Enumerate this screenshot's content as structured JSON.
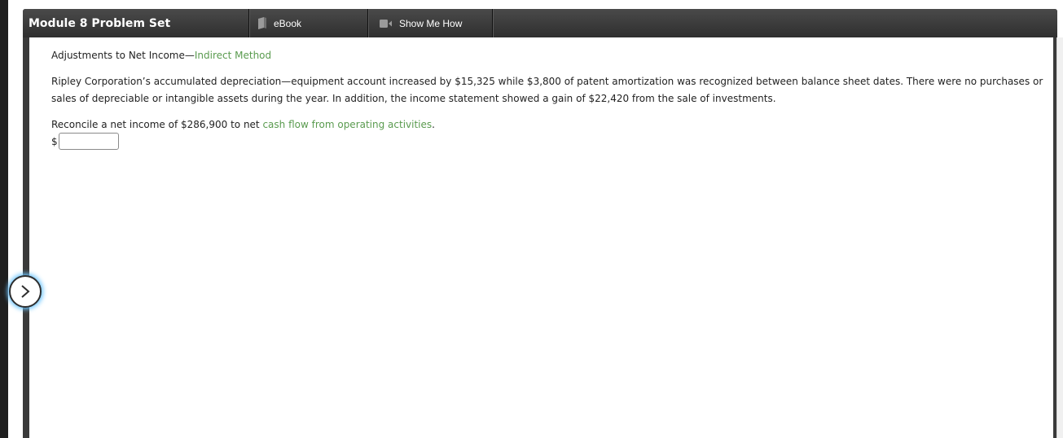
{
  "header": {
    "title": "Module 8 Problem Set",
    "tabs": [
      {
        "label": "eBook",
        "icon": "book-icon"
      },
      {
        "label": "Show Me How",
        "icon": "video-camera-icon"
      }
    ]
  },
  "problem": {
    "heading_prefix": "Adjustments to Net Income—",
    "heading_link": "Indirect Method",
    "paragraph": "Ripley Corporation’s accumulated depreciation—equipment account increased by $15,325 while $3,800 of patent amortization was recognized between balance sheet dates. There were no purchases or sales of depreciable or intangible assets during the year. In addition, the income statement showed a gain of $22,420 from the sale of investments.",
    "question_prefix": "Reconcile a net income of $286,900 to net ",
    "question_link": "cash flow from operating activities",
    "question_suffix": ".",
    "answer_currency": "$",
    "answer_value": ""
  },
  "nav": {
    "next_icon": "chevron-right-icon"
  },
  "colors": {
    "link": "#5a9b4f",
    "header_bg": "#3a3a3a",
    "nav_glow": "#6ec6ff"
  }
}
